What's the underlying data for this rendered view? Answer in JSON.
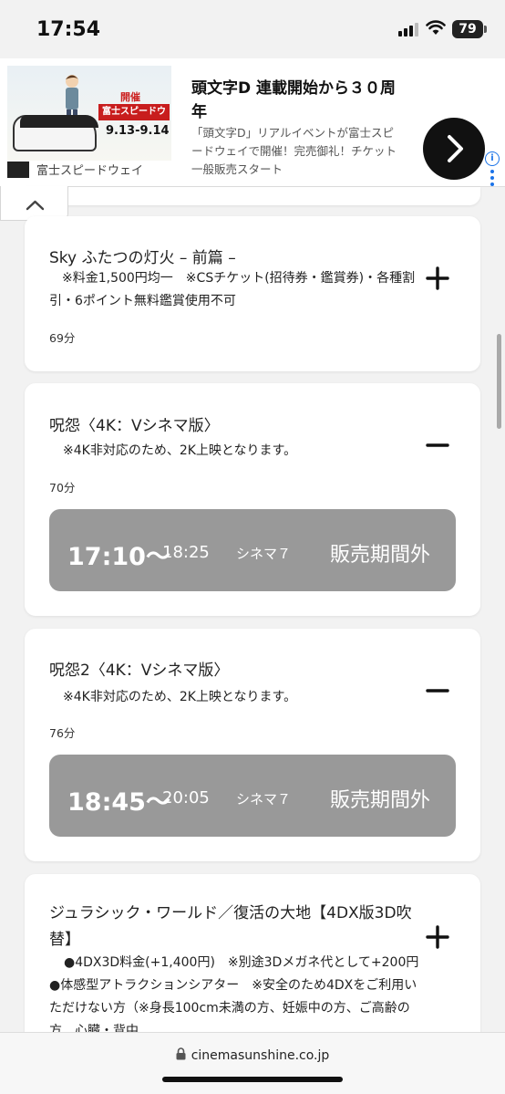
{
  "status_bar": {
    "time": "17:54",
    "battery": "79"
  },
  "ad": {
    "title": "頭文字D 連載開始から３０周年",
    "description": "「頭文字D」リアルイベントが富士スピードウェイで開催！完売御礼！チケット一般販売スタート",
    "brand_name": "富士スピードウェイ",
    "image_kaisai": "開催",
    "image_banner": "富士スピードウェイ",
    "image_dates": "9.13-9.14"
  },
  "movies": [
    {
      "title": "Sky ふたつの灯火 – 前篇 –",
      "note": "※料金1,500円均一　※CSチケット(招待券・鑑賞券)・各種割引・6ポイント無料鑑賞使用不可",
      "duration": "69分",
      "expanded": false
    },
    {
      "title": "呪怨〈4K：Vシネマ版〉",
      "note": "※4K非対応のため、2K上映となります。",
      "duration": "70分",
      "expanded": true,
      "showtime": {
        "start": "17:10〜",
        "end": "18:25",
        "screen": "シネマ７",
        "status": "販売期間外"
      }
    },
    {
      "title": "呪怨2〈4K：Vシネマ版〉",
      "note": "※4K非対応のため、2K上映となります。",
      "duration": "76分",
      "expanded": true,
      "showtime": {
        "start": "18:45〜",
        "end": "20:05",
        "screen": "シネマ７",
        "status": "販売期間外"
      }
    },
    {
      "title": "ジュラシック・ワールド／復活の大地【4DX版3D吹替】",
      "note": "●4DX3D料金(+1,400円)　※別途3Dメガネ代として+200円　●体感型アトラクションシアター　※安全のため4DXをご利用いただけない方（※身長100cm未満の方、妊娠中の方、ご高齢の方、心臓・背中",
      "expanded": false
    }
  ],
  "url_bar": {
    "url": "cinemasunshine.co.jp"
  },
  "colors": {
    "showtime_bg": "#999999",
    "background": "#f2f2f2",
    "card": "#ffffff"
  }
}
